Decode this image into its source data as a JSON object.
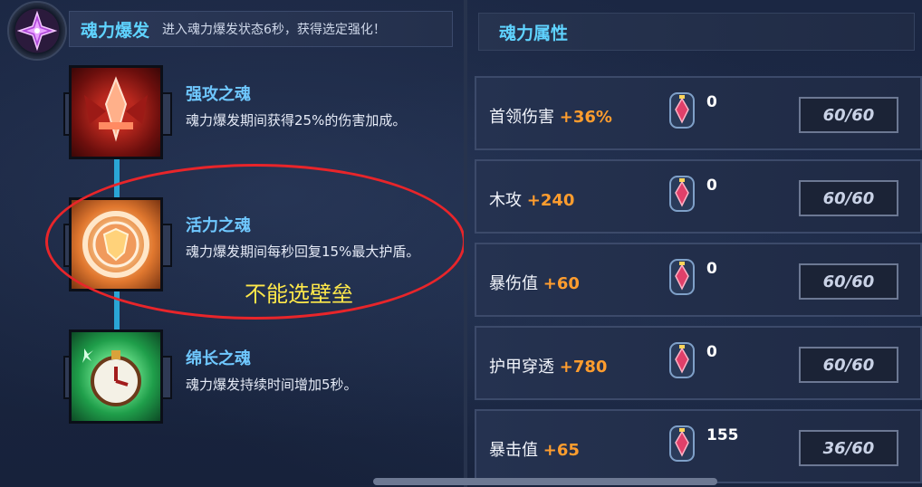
{
  "burst": {
    "title": "魂力爆发",
    "description": "进入魂力爆发状态6秒，获得选定强化！",
    "icon": "purple-crystal-icon"
  },
  "skills": [
    {
      "name": "强攻之魂",
      "description": "魂力爆发期间获得25%的伤害加成。",
      "icon": "red-sword-icon"
    },
    {
      "name": "活力之魂",
      "description": "魂力爆发期间每秒回复15%最大护盾。",
      "icon": "orange-shield-icon"
    },
    {
      "name": "绵长之魂",
      "description": "魂力爆发持续时间增加5秒。",
      "icon": "green-clock-icon"
    }
  ],
  "annotation": "不能选壁垒",
  "attributes": {
    "title": "魂力属性",
    "rows": [
      {
        "label": "首领伤害",
        "value": "+36%",
        "gem_count": "0",
        "level": "60/60"
      },
      {
        "label": "木攻",
        "value": "+240",
        "gem_count": "0",
        "level": "60/60"
      },
      {
        "label": "暴伤值",
        "value": "+60",
        "gem_count": "0",
        "level": "60/60"
      },
      {
        "label": "护甲穿透",
        "value": "+780",
        "gem_count": "0",
        "level": "60/60"
      },
      {
        "label": "暴击值",
        "value": "+65",
        "gem_count": "155",
        "level": "36/60"
      }
    ]
  },
  "colors": {
    "accent": "#5fd3ff",
    "value": "#ff9d2e",
    "annotation": "#ffe94a",
    "highlight_oval": "#e8252a"
  }
}
